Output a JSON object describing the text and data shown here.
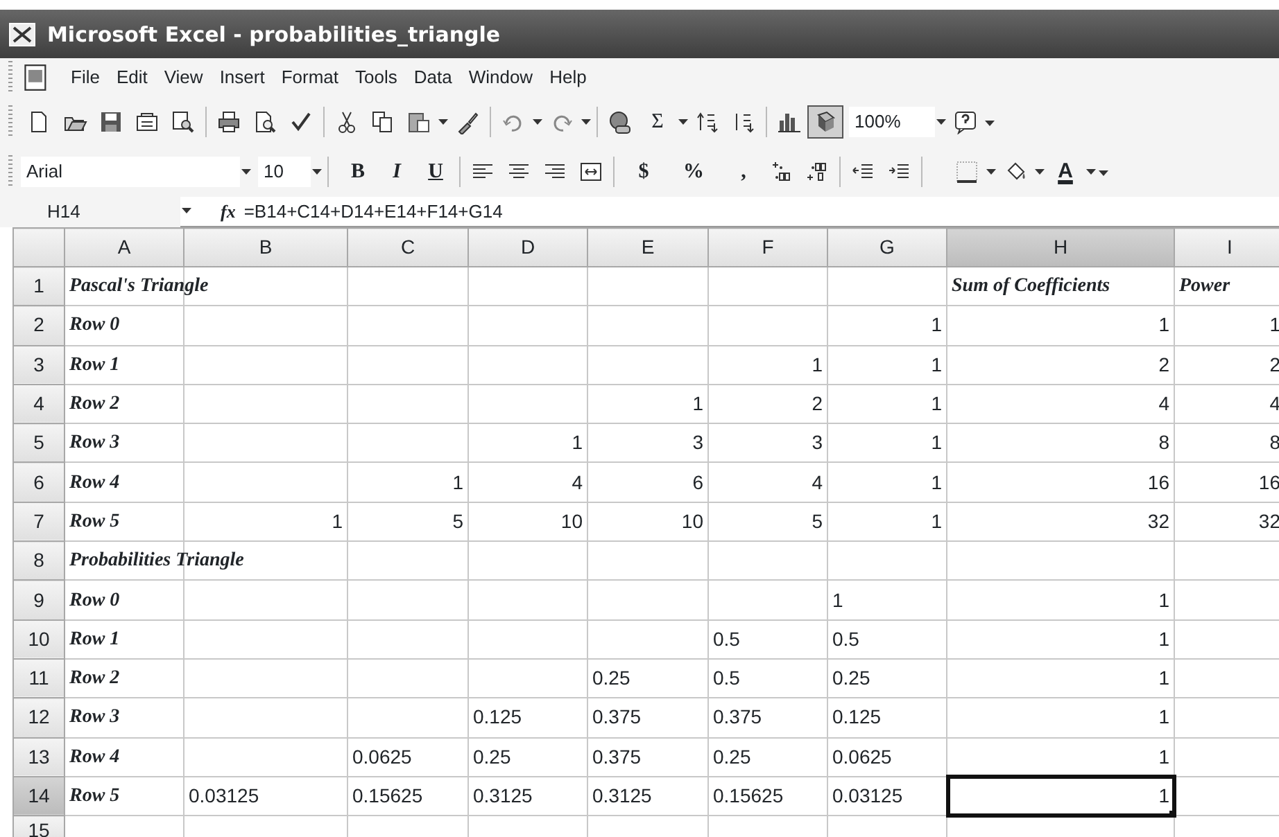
{
  "window": {
    "title": "Microsoft Excel - probabilities_triangle"
  },
  "menu": [
    {
      "label": "File"
    },
    {
      "label": "Edit"
    },
    {
      "label": "View"
    },
    {
      "label": "Insert"
    },
    {
      "label": "Format"
    },
    {
      "label": "Tools"
    },
    {
      "label": "Data"
    },
    {
      "label": "Window"
    },
    {
      "label": "Help"
    }
  ],
  "standard_toolbar": {
    "autosum": "Σ",
    "zoom": "100%",
    "drawing_pressed": true
  },
  "formatting_toolbar": {
    "font": "Arial",
    "size": "10",
    "bold": "B",
    "italic": "I",
    "underline": "U",
    "currency": "$",
    "percent": "%",
    "comma": ",",
    "font_color": "A"
  },
  "formula_bar": {
    "name_box": "H14",
    "fx": "fx",
    "formula": "=B14+C14+D14+E14+F14+G14"
  },
  "columns": [
    {
      "label": "A",
      "selected": false
    },
    {
      "label": "B",
      "selected": false
    },
    {
      "label": "C",
      "selected": false
    },
    {
      "label": "D",
      "selected": false
    },
    {
      "label": "E",
      "selected": false
    },
    {
      "label": "F",
      "selected": false
    },
    {
      "label": "G",
      "selected": false
    },
    {
      "label": "H",
      "selected": true
    },
    {
      "label": "I",
      "selected": false
    }
  ],
  "rows": [
    {
      "number": "1",
      "selected": false,
      "cells": [
        {
          "text": "Pascal's Triangle",
          "kind": "label",
          "selected": false
        },
        null,
        null,
        null,
        null,
        null,
        null,
        {
          "text": "Sum of Coefficients",
          "kind": "heading",
          "selected": false
        },
        {
          "text": "Power",
          "kind": "label",
          "selected": false
        }
      ]
    },
    {
      "number": "2",
      "selected": false,
      "cells": [
        {
          "text": "Row 0",
          "kind": "label",
          "selected": false
        },
        null,
        null,
        null,
        null,
        null,
        {
          "text": "1",
          "kind": "number",
          "selected": false
        },
        {
          "text": "1",
          "kind": "number",
          "selected": false
        },
        {
          "text": "1",
          "kind": "number",
          "selected": false
        }
      ]
    },
    {
      "number": "3",
      "selected": false,
      "cells": [
        {
          "text": "Row 1",
          "kind": "label",
          "selected": false
        },
        null,
        null,
        null,
        null,
        {
          "text": "1",
          "kind": "number",
          "selected": false
        },
        {
          "text": "1",
          "kind": "number",
          "selected": false
        },
        {
          "text": "2",
          "kind": "number",
          "selected": false
        },
        {
          "text": "2",
          "kind": "number",
          "selected": false
        }
      ]
    },
    {
      "number": "4",
      "selected": false,
      "cells": [
        {
          "text": "Row 2",
          "kind": "label",
          "selected": false
        },
        null,
        null,
        null,
        {
          "text": "1",
          "kind": "number",
          "selected": false
        },
        {
          "text": "2",
          "kind": "number",
          "selected": false
        },
        {
          "text": "1",
          "kind": "number",
          "selected": false
        },
        {
          "text": "4",
          "kind": "number",
          "selected": false
        },
        {
          "text": "4",
          "kind": "number",
          "selected": false
        }
      ]
    },
    {
      "number": "5",
      "selected": false,
      "cells": [
        {
          "text": "Row 3",
          "kind": "label",
          "selected": false
        },
        null,
        null,
        {
          "text": "1",
          "kind": "number",
          "selected": false
        },
        {
          "text": "3",
          "kind": "number",
          "selected": false
        },
        {
          "text": "3",
          "kind": "number",
          "selected": false
        },
        {
          "text": "1",
          "kind": "number",
          "selected": false
        },
        {
          "text": "8",
          "kind": "number",
          "selected": false
        },
        {
          "text": "8",
          "kind": "number",
          "selected": false
        }
      ]
    },
    {
      "number": "6",
      "selected": false,
      "cells": [
        {
          "text": "Row 4",
          "kind": "label",
          "selected": false
        },
        null,
        {
          "text": "1",
          "kind": "number",
          "selected": false
        },
        {
          "text": "4",
          "kind": "number",
          "selected": false
        },
        {
          "text": "6",
          "kind": "number",
          "selected": false
        },
        {
          "text": "4",
          "kind": "number",
          "selected": false
        },
        {
          "text": "1",
          "kind": "number",
          "selected": false
        },
        {
          "text": "16",
          "kind": "number",
          "selected": false
        },
        {
          "text": "16",
          "kind": "number",
          "selected": false
        }
      ]
    },
    {
      "number": "7",
      "selected": false,
      "cells": [
        {
          "text": "Row 5",
          "kind": "label",
          "selected": false
        },
        {
          "text": "1",
          "kind": "number",
          "selected": false
        },
        {
          "text": "5",
          "kind": "number",
          "selected": false
        },
        {
          "text": "10",
          "kind": "number",
          "selected": false
        },
        {
          "text": "10",
          "kind": "number",
          "selected": false
        },
        {
          "text": "5",
          "kind": "number",
          "selected": false
        },
        {
          "text": "1",
          "kind": "number",
          "selected": false
        },
        {
          "text": "32",
          "kind": "number",
          "selected": false
        },
        {
          "text": "32",
          "kind": "number",
          "selected": false
        }
      ]
    },
    {
      "number": "8",
      "selected": false,
      "cells": [
        {
          "text": "Probabilities Triangle",
          "kind": "label",
          "selected": false
        },
        null,
        null,
        null,
        null,
        null,
        null,
        null,
        null
      ]
    },
    {
      "number": "9",
      "selected": false,
      "cells": [
        {
          "text": "Row 0",
          "kind": "label",
          "selected": false
        },
        null,
        null,
        null,
        null,
        null,
        {
          "text": "1",
          "kind": "text",
          "selected": false
        },
        {
          "text": "1",
          "kind": "number",
          "selected": false
        },
        null
      ]
    },
    {
      "number": "10",
      "selected": false,
      "cells": [
        {
          "text": "Row 1",
          "kind": "label",
          "selected": false
        },
        null,
        null,
        null,
        null,
        {
          "text": "0.5",
          "kind": "text",
          "selected": false
        },
        {
          "text": "0.5",
          "kind": "text",
          "selected": false
        },
        {
          "text": "1",
          "kind": "number",
          "selected": false
        },
        null
      ]
    },
    {
      "number": "11",
      "selected": false,
      "cells": [
        {
          "text": "Row 2",
          "kind": "label",
          "selected": false
        },
        null,
        null,
        null,
        {
          "text": "0.25",
          "kind": "text",
          "selected": false
        },
        {
          "text": "0.5",
          "kind": "text",
          "selected": false
        },
        {
          "text": "0.25",
          "kind": "text",
          "selected": false
        },
        {
          "text": "1",
          "kind": "number",
          "selected": false
        },
        null
      ]
    },
    {
      "number": "12",
      "selected": false,
      "cells": [
        {
          "text": "Row 3",
          "kind": "label",
          "selected": false
        },
        null,
        null,
        {
          "text": "0.125",
          "kind": "text",
          "selected": false
        },
        {
          "text": "0.375",
          "kind": "text",
          "selected": false
        },
        {
          "text": "0.375",
          "kind": "text",
          "selected": false
        },
        {
          "text": "0.125",
          "kind": "text",
          "selected": false
        },
        {
          "text": "1",
          "kind": "number",
          "selected": false
        },
        null
      ]
    },
    {
      "number": "13",
      "selected": false,
      "cells": [
        {
          "text": "Row 4",
          "kind": "label",
          "selected": false
        },
        null,
        {
          "text": "0.0625",
          "kind": "text",
          "selected": false
        },
        {
          "text": "0.25",
          "kind": "text",
          "selected": false
        },
        {
          "text": "0.375",
          "kind": "text",
          "selected": false
        },
        {
          "text": "0.25",
          "kind": "text",
          "selected": false
        },
        {
          "text": "0.0625",
          "kind": "text",
          "selected": false
        },
        {
          "text": "1",
          "kind": "number",
          "selected": false
        },
        null
      ]
    },
    {
      "number": "14",
      "selected": true,
      "cells": [
        {
          "text": "Row 5",
          "kind": "label",
          "selected": false
        },
        {
          "text": "0.03125",
          "kind": "text",
          "selected": false
        },
        {
          "text": "0.15625",
          "kind": "text",
          "selected": false
        },
        {
          "text": "0.3125",
          "kind": "text",
          "selected": false
        },
        {
          "text": "0.3125",
          "kind": "text",
          "selected": false
        },
        {
          "text": "0.15625",
          "kind": "text",
          "selected": false
        },
        {
          "text": "0.03125",
          "kind": "text",
          "selected": false
        },
        {
          "text": "1",
          "kind": "number",
          "selected": true
        },
        null
      ]
    },
    {
      "number": "15",
      "selected": false,
      "cells": [
        null,
        null,
        null,
        null,
        null,
        null,
        null,
        null,
        null
      ]
    }
  ]
}
